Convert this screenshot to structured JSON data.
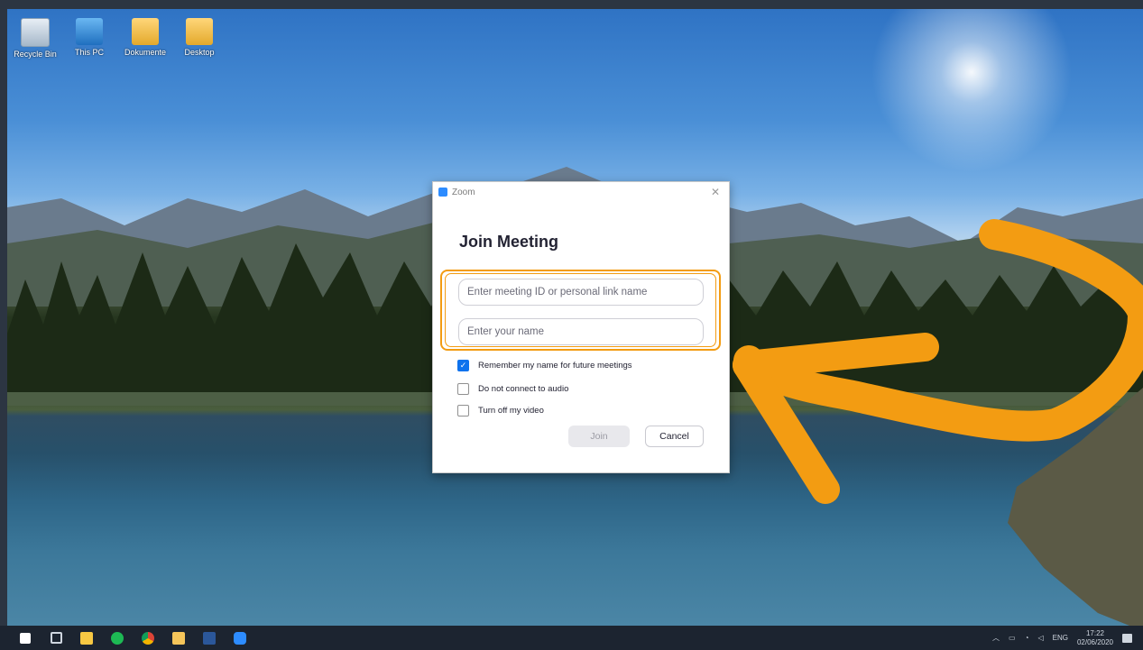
{
  "desktop": {
    "icons": [
      {
        "label": "Recycle Bin"
      },
      {
        "label": "This PC"
      },
      {
        "label": "Dokumente"
      },
      {
        "label": "Desktop"
      }
    ]
  },
  "dialog": {
    "window_title": "Zoom",
    "heading": "Join Meeting",
    "meeting_id_placeholder": "Enter meeting ID or personal link name",
    "name_placeholder": "Enter your name",
    "options": [
      {
        "label": "Remember my name for future meetings",
        "checked": true
      },
      {
        "label": "Do not connect to audio",
        "checked": false
      },
      {
        "label": "Turn off my video",
        "checked": false
      }
    ],
    "join_label": "Join",
    "cancel_label": "Cancel"
  },
  "taskbar": {
    "language": "ENG",
    "time": "17:22",
    "date": "02/06/2020"
  },
  "colors": {
    "highlight": "#f39c12",
    "zoom_blue": "#2d8cff",
    "checkbox_blue": "#0e72ed"
  }
}
